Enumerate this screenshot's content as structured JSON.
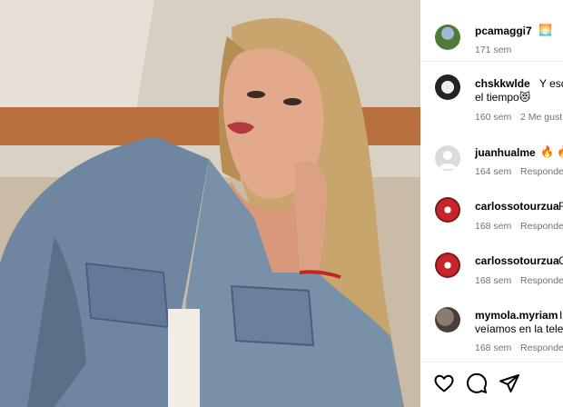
{
  "post": {
    "author": "pcamaggi7",
    "caption_emoji": "🌅",
    "time": "171 sem"
  },
  "comments": [
    {
      "user": "chskkwlde",
      "text": "Y esos",
      "text_line2": "el tiempo😻",
      "time": "160 sem",
      "likes": "2 Me gust"
    },
    {
      "user": "juanhualme",
      "text": "🔥 🔥",
      "time": "164 sem",
      "reply": "Responde"
    },
    {
      "user": "carlossotourzua",
      "text": "F",
      "time": "168 sem",
      "reply": "Responde"
    },
    {
      "user": "carlossotourzua",
      "text": "C",
      "time": "168 sem",
      "reply": "Responde"
    },
    {
      "user": "mymola.myriam",
      "text": "I",
      "text_line2": "veíamos en la tele",
      "time": "168 sem",
      "reply": "Responde"
    }
  ],
  "actions": {
    "like_icon": "heart-icon",
    "comment_icon": "comment-icon",
    "share_icon": "share-icon"
  }
}
